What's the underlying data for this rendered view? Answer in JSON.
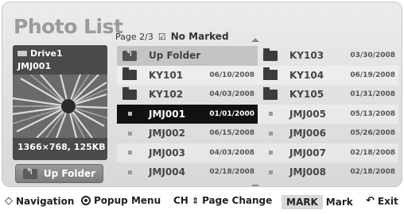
{
  "window": {
    "title": "Photo List"
  },
  "page_info": {
    "page": "Page 2/3",
    "mark_status": "No Marked"
  },
  "preview": {
    "drive": "Drive1",
    "filename": "JMJ001",
    "dimensions": "1366×768, 125KB"
  },
  "up_folder_button": {
    "label": "Up Folder"
  },
  "files_left": [
    {
      "name": "Up Folder",
      "date": "",
      "type": "up-folder"
    },
    {
      "name": "KY101",
      "date": "06/10/2008",
      "type": "folder"
    },
    {
      "name": "KY102",
      "date": "04/03/2008",
      "type": "folder"
    },
    {
      "name": "JMJ001",
      "date": "01/01/2000",
      "type": "file",
      "selected": true
    },
    {
      "name": "JMJ002",
      "date": "06/15/2008",
      "type": "file"
    },
    {
      "name": "JMJ003",
      "date": "04/03/2008",
      "type": "file"
    },
    {
      "name": "JMJ004",
      "date": "02/18/2008",
      "type": "file"
    }
  ],
  "files_right": [
    {
      "name": "KY103",
      "date": "03/30/2008",
      "type": "folder"
    },
    {
      "name": "KY104",
      "date": "06/19/2008",
      "type": "folder"
    },
    {
      "name": "KY105",
      "date": "01/31/2008",
      "type": "folder"
    },
    {
      "name": "JMJ005",
      "date": "05/13/2008",
      "type": "file"
    },
    {
      "name": "JMJ006",
      "date": "05/26/2008",
      "type": "file"
    },
    {
      "name": "JMJ007",
      "date": "02/18/2008",
      "type": "file"
    },
    {
      "name": "JMJ008",
      "date": "02/18/2008",
      "type": "file"
    }
  ],
  "bottom_bar": {
    "navigation": "Navigation",
    "popup_menu": "Popup Menu",
    "ch": "CH",
    "page_change": "Page Change",
    "mark_key": "MARK",
    "mark": "Mark",
    "exit": "Exit"
  },
  "colors": {
    "panel_bg": "#e2e2e2",
    "selected_row": "#111111",
    "title_text": "#9a9a9a"
  }
}
